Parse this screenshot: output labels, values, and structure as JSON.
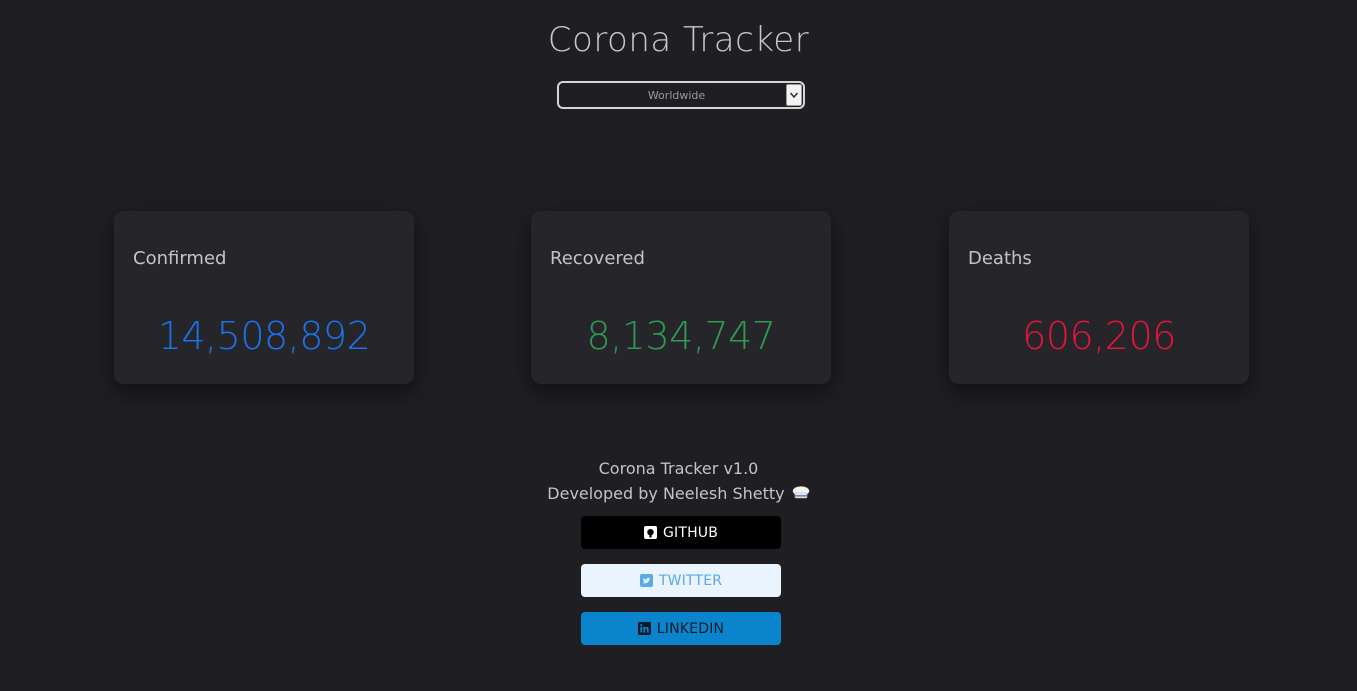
{
  "app": {
    "title": "Corona Tracker"
  },
  "country_select": {
    "selected": "Worldwide"
  },
  "cards": {
    "confirmed": {
      "label": "Confirmed",
      "value": "14,508,892",
      "color": "#1a73e8"
    },
    "recovered": {
      "label": "Recovered",
      "value": "8,134,747",
      "color": "#2e9a55"
    },
    "deaths": {
      "label": "Deaths",
      "value": "606,206",
      "color": "#e0163c"
    }
  },
  "footer": {
    "version": "Corona Tracker v1.0",
    "developer": "Developed by Neelesh Shetty",
    "developer_icon": "chef-hat-icon"
  },
  "social": {
    "github": {
      "label": "GITHUB",
      "icon": "github-icon"
    },
    "twitter": {
      "label": "TWITTER",
      "icon": "twitter-icon"
    },
    "linkedin": {
      "label": "LINKEDIN",
      "icon": "linkedin-icon"
    }
  }
}
